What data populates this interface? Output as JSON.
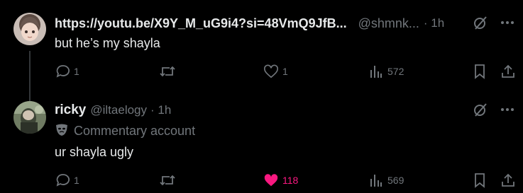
{
  "post1": {
    "display_name": "https://youtu.be/X9Y_M_uG9i4?si=48VmQ9JfB...",
    "handle": "@shmnk...",
    "time": "· 1h",
    "text": "but he’s my shayla",
    "replies": "1",
    "reposts": "",
    "likes": "1",
    "views": "572"
  },
  "post2": {
    "display_name": "ricky",
    "handle": "@iltaelogy",
    "time": "· 1h",
    "label": "Commentary account",
    "text": "ur shayla ugly",
    "replies": "1",
    "reposts": "",
    "likes": "118",
    "views": "569"
  },
  "colors": {
    "background": "#000000",
    "text": "#e7e9ea",
    "muted": "#71767b",
    "like_active": "#f91880",
    "thread_line": "#333639"
  },
  "icons": [
    "grok-icon",
    "more-icon",
    "reply-icon",
    "repost-icon",
    "like-icon",
    "views-icon",
    "bookmark-icon",
    "share-icon",
    "mask-icon"
  ]
}
